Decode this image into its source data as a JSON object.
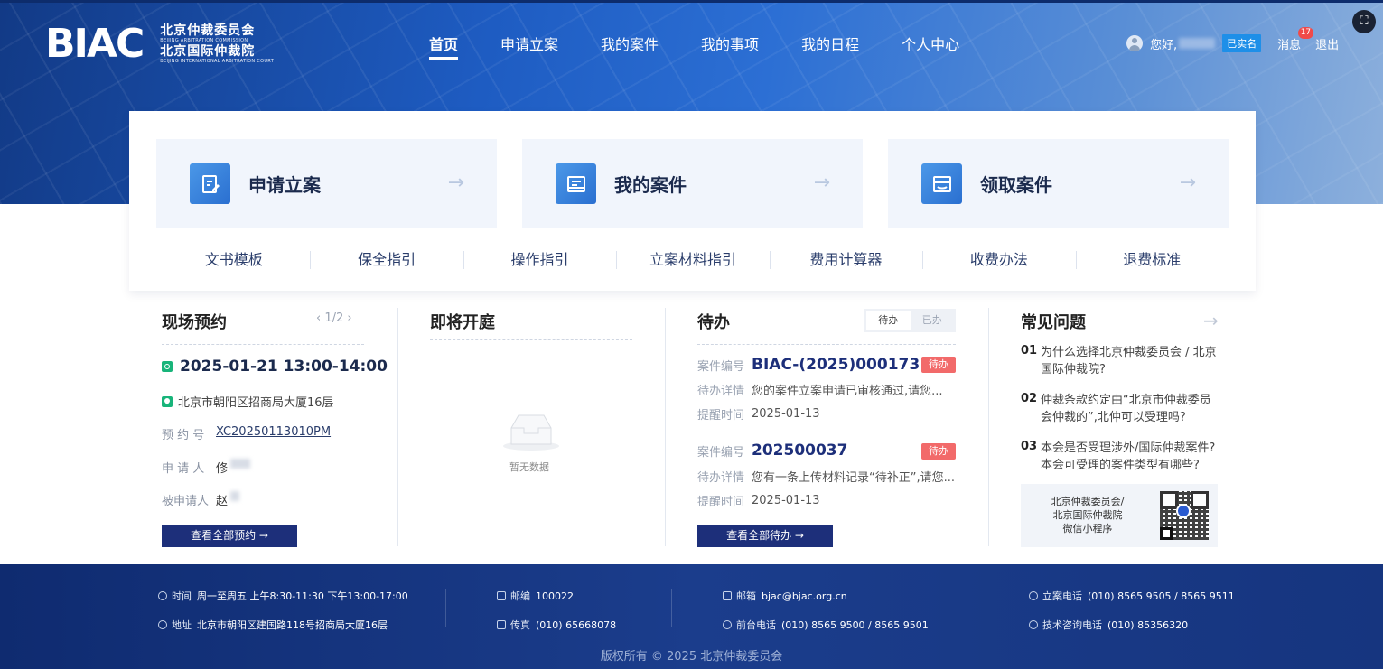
{
  "header": {
    "logo_mark": "BIAC",
    "logo_cn_1": "北京仲裁委员会",
    "logo_en_1": "BEIJING ARBITRATION COMMISSION",
    "logo_cn_2": "北京国际仲裁院",
    "logo_en_2": "BEIJING INTERNATIONAL ARBITRATION COURT",
    "nav": [
      "首页",
      "申请立案",
      "我的案件",
      "我的事项",
      "我的日程",
      "个人中心"
    ],
    "greeting": "您好,",
    "verified": "已实名",
    "messages_label": "消息",
    "messages_count": "17",
    "logout": "退出"
  },
  "actions": [
    {
      "label": "申请立案",
      "icon": "edit-doc-icon"
    },
    {
      "label": "我的案件",
      "icon": "case-folder-icon"
    },
    {
      "label": "领取案件",
      "icon": "receive-case-icon"
    }
  ],
  "quick_links": [
    "文书模板",
    "保全指引",
    "操作指引",
    "立案材料指引",
    "费用计算器",
    "收费办法",
    "退费标准"
  ],
  "appointment": {
    "title": "现场预约",
    "pager": "1/2",
    "time": "2025-01-21 13:00-14:00",
    "address": "北京市朝阳区招商局大厦16层",
    "fields": [
      {
        "label": "预 约 号",
        "value": "XC20250113010PM"
      },
      {
        "label": "申 请 人",
        "value": "修"
      },
      {
        "label": "被申请人",
        "value": "赵"
      }
    ],
    "button": "查看全部预约 →"
  },
  "hearing": {
    "title": "即将开庭",
    "empty": "暂无数据"
  },
  "todo": {
    "title": "待办",
    "tabs": [
      "待办",
      "已办"
    ],
    "items": [
      {
        "case_label": "案件编号",
        "case_no": "BIAC-(2025)000173",
        "badge": "待办",
        "detail_label": "待办详情",
        "detail": "您的案件立案申请已审核通过,请您...",
        "time_label": "提醒时间",
        "time": "2025-01-13"
      },
      {
        "case_label": "案件编号",
        "case_no": "202500037",
        "badge": "待办",
        "detail_label": "待办详情",
        "detail": "您有一条上传材料记录“待补正”,请您...",
        "time_label": "提醒时间",
        "time": "2025-01-13"
      }
    ],
    "button": "查看全部待办 →"
  },
  "faq": {
    "title": "常见问题",
    "items": [
      {
        "n": "01",
        "q": "为什么选择北京仲裁委员会 / 北京国际仲裁院?"
      },
      {
        "n": "02",
        "q": "仲裁条款约定由“北京市仲裁委员会仲裁的”,北仲可以受理吗?"
      },
      {
        "n": "03",
        "q": "本会是否受理涉外/国际仲裁案件?本会可受理的案件类型有哪些?"
      }
    ],
    "qr_text": "北京仲裁委员会/\n北京国际仲裁院\n微信小程序"
  },
  "footer": {
    "time_label": "时间",
    "time": "周一至周五 上午8:30-11:30 下午13:00-17:00",
    "addr_label": "地址",
    "addr": "北京市朝阳区建国路118号招商局大厦16层",
    "zip_label": "邮编",
    "zip": "100022",
    "fax_label": "传真",
    "fax": "(010) 65668078",
    "email_label": "邮箱",
    "email": "bjac@bjac.org.cn",
    "front_label": "前台电话",
    "front": "(010) 8565 9500 / 8565 9501",
    "filing_label": "立案电话",
    "filing": "(010) 8565 9505 / 8565 9511",
    "tech_label": "技术咨询电话",
    "tech": "(010) 85356320",
    "copyright": "版权所有 © 2025 北京仲裁委员会"
  }
}
